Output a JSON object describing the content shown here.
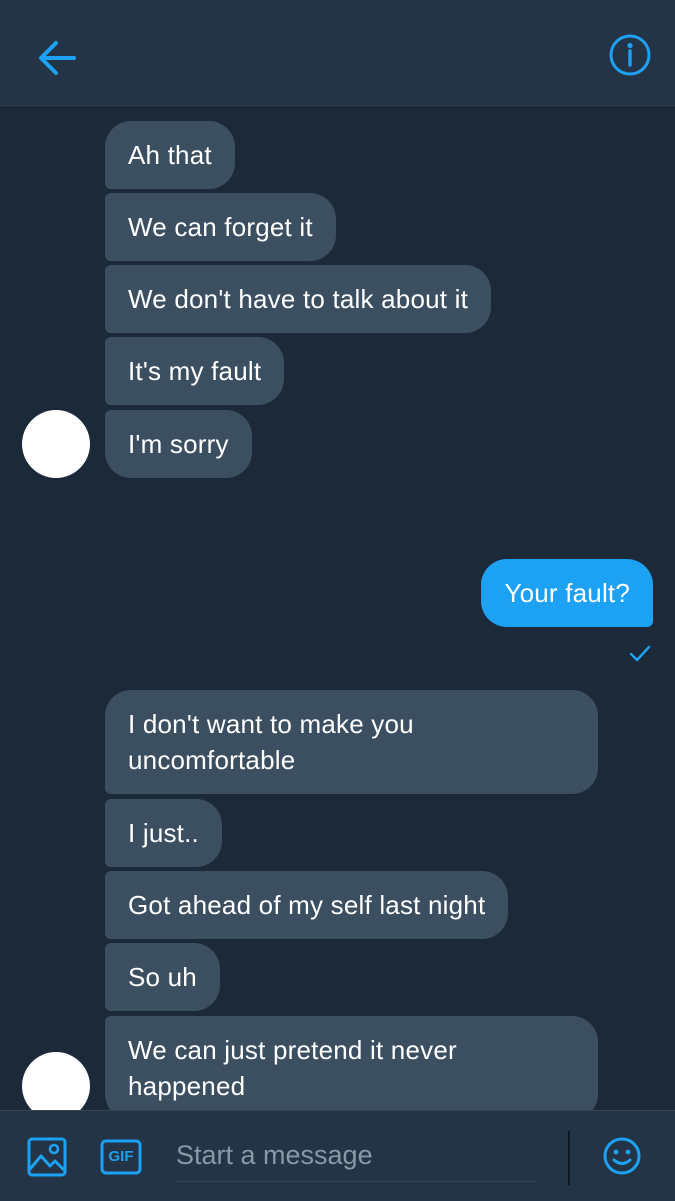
{
  "header": {
    "back_icon": "arrow-left-icon",
    "info_icon": "info-circle-icon"
  },
  "thread": {
    "group1": [
      "Ah that",
      "We can forget it",
      "We don't have to talk about it",
      "It's my fault",
      "I'm sorry"
    ],
    "outgoing": {
      "text": "Your fault?",
      "status_icon": "checkmark-icon"
    },
    "group2": [
      "I don't want to make you\nuncomfortable",
      "I just..",
      "Got ahead of my self last night",
      "So uh",
      "We can just pretend it never\nhappened"
    ]
  },
  "composer": {
    "placeholder": "Start a message",
    "media_icon": "image-icon",
    "gif_label": "GIF",
    "emoji_icon": "smiley-icon"
  },
  "colors": {
    "background": "#1c2938",
    "header": "#243447",
    "incoming_bubble": "#3c4f61",
    "outgoing_bubble": "#1da1f2",
    "accent": "#1da1f2"
  }
}
